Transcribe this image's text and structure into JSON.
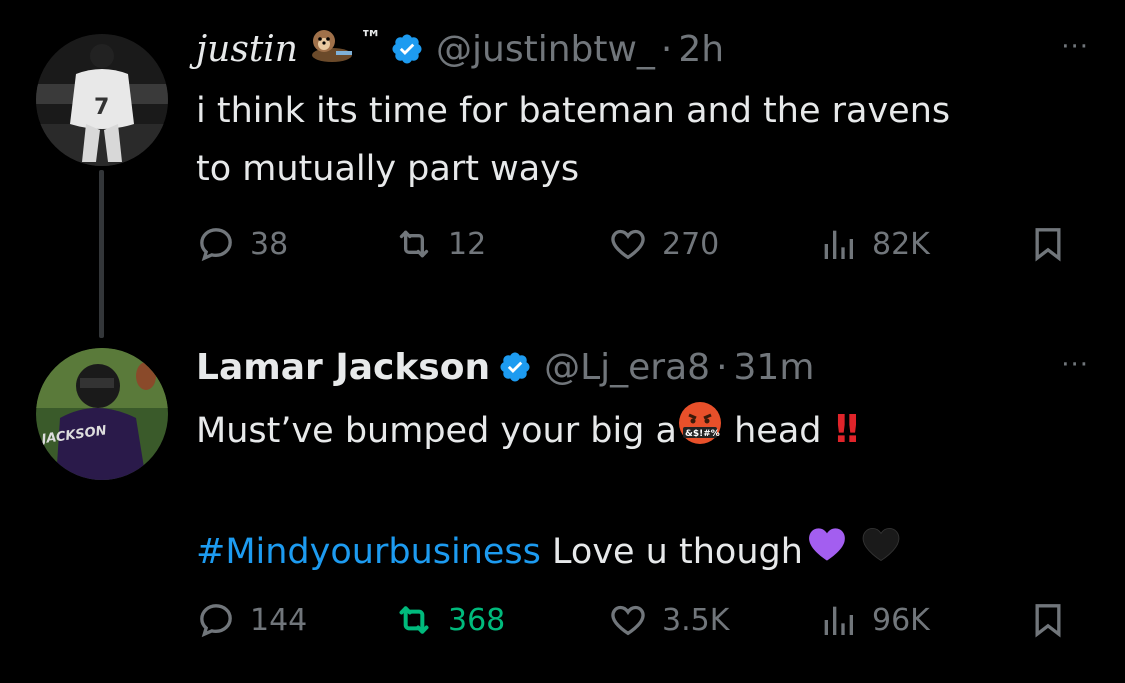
{
  "tweets": [
    {
      "name": "justin",
      "emoji_after_name": "otter-icon",
      "trademark": "™",
      "handle": "@justinbtw_",
      "separator": "·",
      "time": "2h",
      "more": "···",
      "text_line1": "i think its time for bateman and the ravens",
      "text_line2": "to mutually part ways",
      "stats": {
        "replies": "38",
        "retweets": "12",
        "likes": "270",
        "views": "82K"
      }
    },
    {
      "name": "Lamar Jackson",
      "handle": "@Lj_era8",
      "separator": "·",
      "time": "31m",
      "more": "···",
      "text_line1_a": "Must’ve bumped your big a",
      "text_line1_b": " head",
      "hashtag": "#Mindyourbusiness",
      "text_line3_rest": " Love u though",
      "avatar_jersey_text": "JACKSON",
      "stats": {
        "replies": "144",
        "retweets": "368",
        "likes": "3.5K",
        "views": "96K"
      }
    }
  ],
  "colors": {
    "background": "#000000",
    "text": "#e7e9ea",
    "muted": "#71767b",
    "link": "#1d9bf0",
    "verified": "#1d9bf0",
    "retweet_active": "#00ba7c",
    "thread_line": "#333639"
  }
}
